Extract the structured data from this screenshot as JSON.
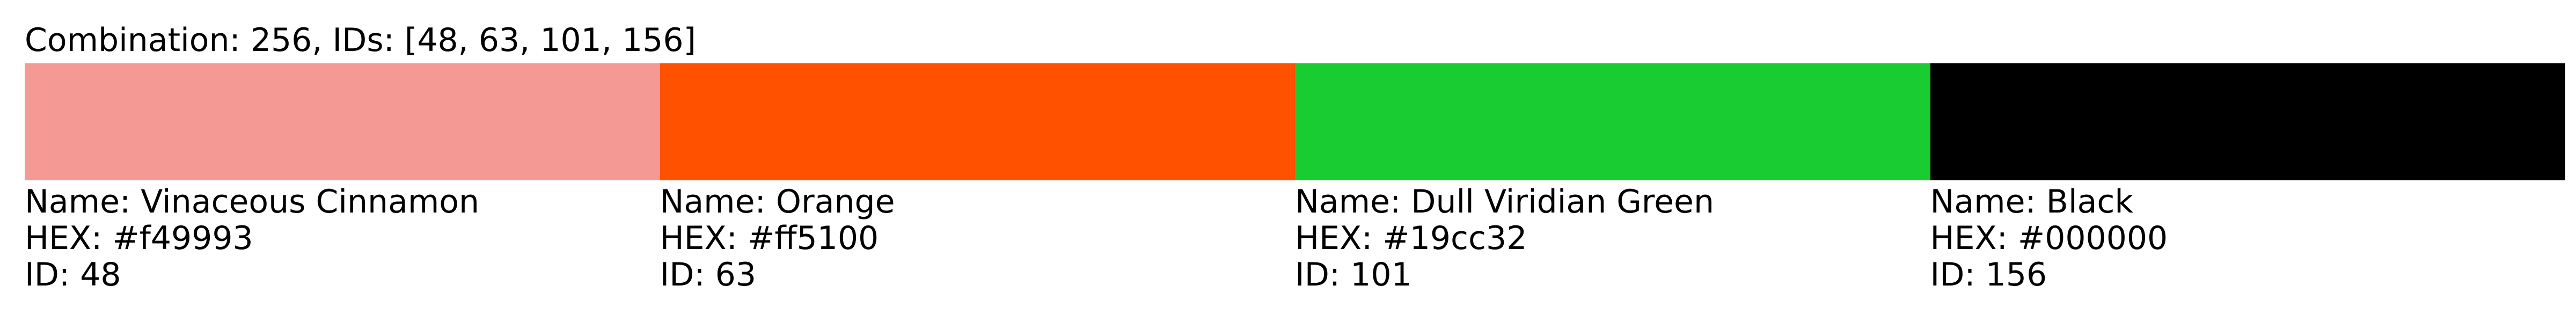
{
  "title": "Combination: 256, IDs: [48, 63, 101, 156]",
  "swatches": [
    {
      "name_text": "Name: Vinaceous Cinnamon",
      "hex_text": "HEX: #f49993",
      "id_text": "ID: 48",
      "color": "#f49993"
    },
    {
      "name_text": "Name: Orange",
      "hex_text": "HEX: #ff5100",
      "id_text": "ID: 63",
      "color": "#ff5100"
    },
    {
      "name_text": "Name: Dull Viridian Green",
      "hex_text": "HEX: #19cc32",
      "id_text": "ID: 101",
      "color": "#19cc32"
    },
    {
      "name_text": "Name: Black",
      "hex_text": "HEX: #000000",
      "id_text": "ID: 156",
      "color": "#000000"
    }
  ]
}
